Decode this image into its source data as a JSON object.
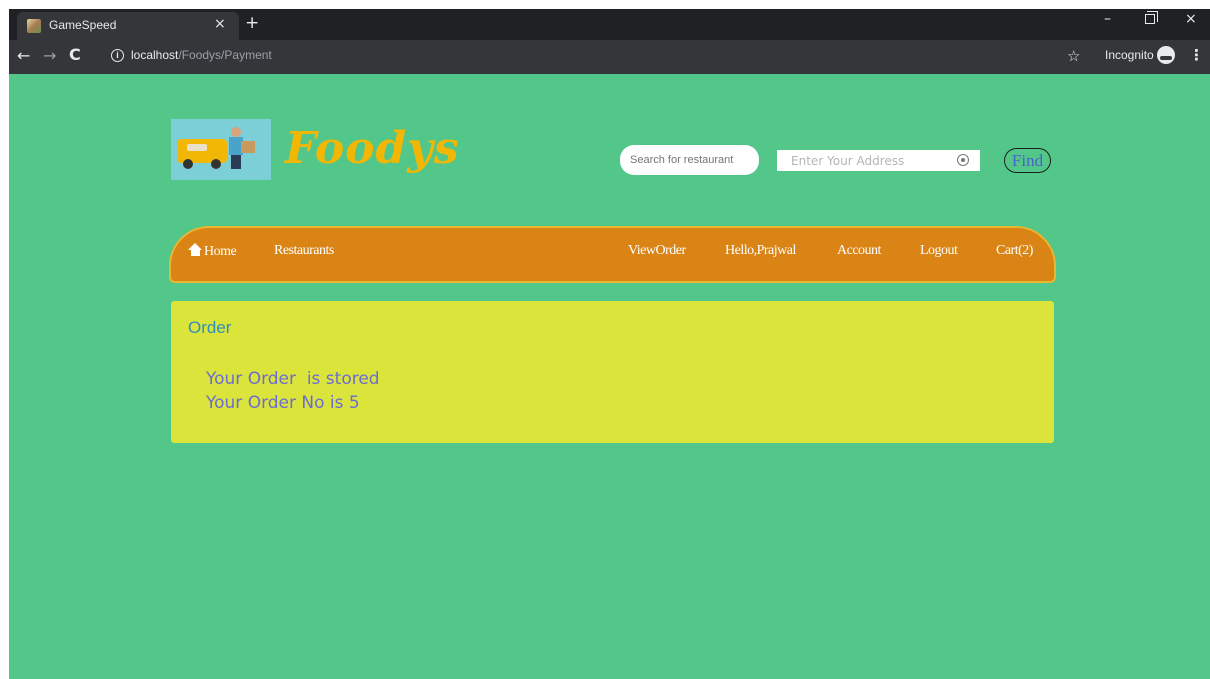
{
  "browser": {
    "tab_title": "GameSpeed",
    "tab_close": "×",
    "new_tab": "+",
    "url_host": "localhost",
    "url_path": "/Foodys/Payment",
    "incognito_label": "Incognito",
    "nav_back": "←",
    "nav_forward": "→",
    "nav_reload": "C",
    "info_glyph": "i",
    "star_glyph": "☆",
    "menu_glyph": "⋮",
    "win_min": "–",
    "win_close": "×"
  },
  "header": {
    "brand": "Foodys",
    "search_placeholder": "Search for restaurant",
    "address_placeholder": "Enter Your Address",
    "find_label": "Find"
  },
  "navbar": {
    "home": "Home",
    "restaurants": "Restaurants",
    "view_order": "ViewOrder",
    "hello": "Hello,Prajwal",
    "account": "Account",
    "logout": "Logout",
    "cart": "Cart(2)"
  },
  "order": {
    "heading": "Order",
    "message_1": "Your Order  is stored",
    "message_2": "Your Order No is 5"
  },
  "colors": {
    "page_bg": "#53c78a",
    "brand": "#f2b705",
    "navbar_bg": "#d98414",
    "panel_bg": "#dbe43b",
    "panel_heading": "#2f8fb8",
    "panel_text": "#6b6bd6"
  }
}
